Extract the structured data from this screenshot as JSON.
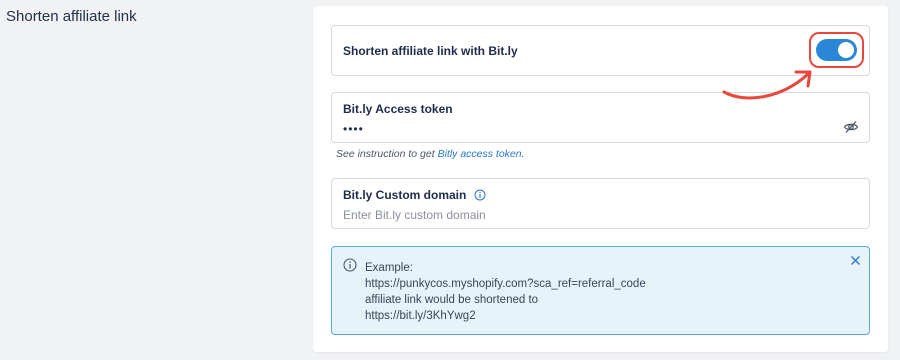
{
  "section": {
    "title": "Shorten affiliate link"
  },
  "toggle": {
    "label": "Shorten affiliate link with Bit.ly",
    "enabled": true,
    "accent": "#2a86d6",
    "highlight_color": "#e8473b"
  },
  "token": {
    "label": "Bit.ly Access token",
    "value": "••••",
    "icon": "eye-off-icon"
  },
  "help": {
    "prefix": "See instruction to get ",
    "link": "Bitly access token",
    "suffix": "."
  },
  "domain": {
    "label": "Bit.ly Custom domain",
    "placeholder": "Enter Bit.ly custom domain",
    "icon": "info-icon"
  },
  "example": {
    "lines": [
      "Example:",
      "https://punkycos.myshopify.com?sca_ref=referral_code",
      "affiliate link would be shortened to",
      "https://bit.ly/3KhYwg2"
    ],
    "icon": "info-icon",
    "close_icon": "close-icon",
    "background": "#e6f3fb",
    "border": "#5aa7d8"
  }
}
